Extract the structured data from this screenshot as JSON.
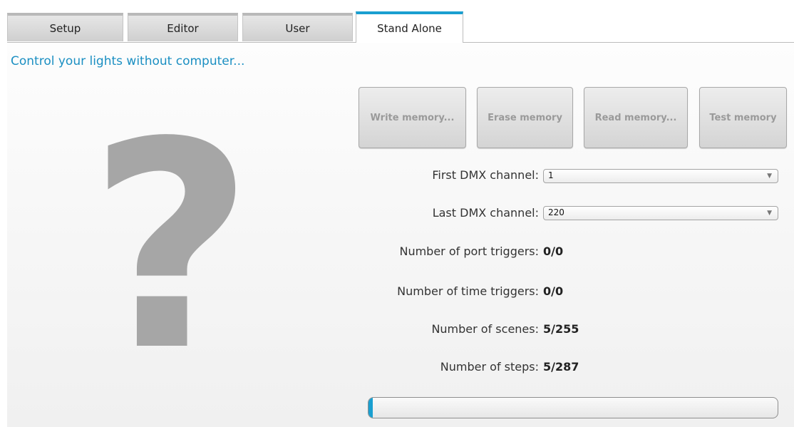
{
  "tabs": [
    {
      "label": "Setup"
    },
    {
      "label": "Editor"
    },
    {
      "label": "User"
    },
    {
      "label": "Stand Alone",
      "active": true
    }
  ],
  "subtitle": "Control your lights without computer...",
  "placeholder_icon": "question-mark-icon",
  "placeholder_glyph": "?",
  "memory_buttons": [
    {
      "label": "Write memory..."
    },
    {
      "label": "Erase memory"
    },
    {
      "label": "Read memory..."
    },
    {
      "label": "Test memory"
    }
  ],
  "fields": {
    "first_dmx_label": "First DMX channel:",
    "first_dmx_value": "1",
    "last_dmx_label": "Last DMX channel:",
    "last_dmx_value": "220",
    "port_triggers_label": "Number of port triggers:",
    "port_triggers_value": "0/0",
    "time_triggers_label": "Number of time triggers:",
    "time_triggers_value": "0/0",
    "scenes_label": "Number of scenes:",
    "scenes_value": "5/255",
    "steps_label": "Number of steps:",
    "steps_value": "5/287"
  },
  "progress": {
    "value_fraction": 0.01
  },
  "colors": {
    "accent": "#1a9fd0",
    "subtitle": "#1b8fc2",
    "icon_gray": "#a6a6a6"
  }
}
